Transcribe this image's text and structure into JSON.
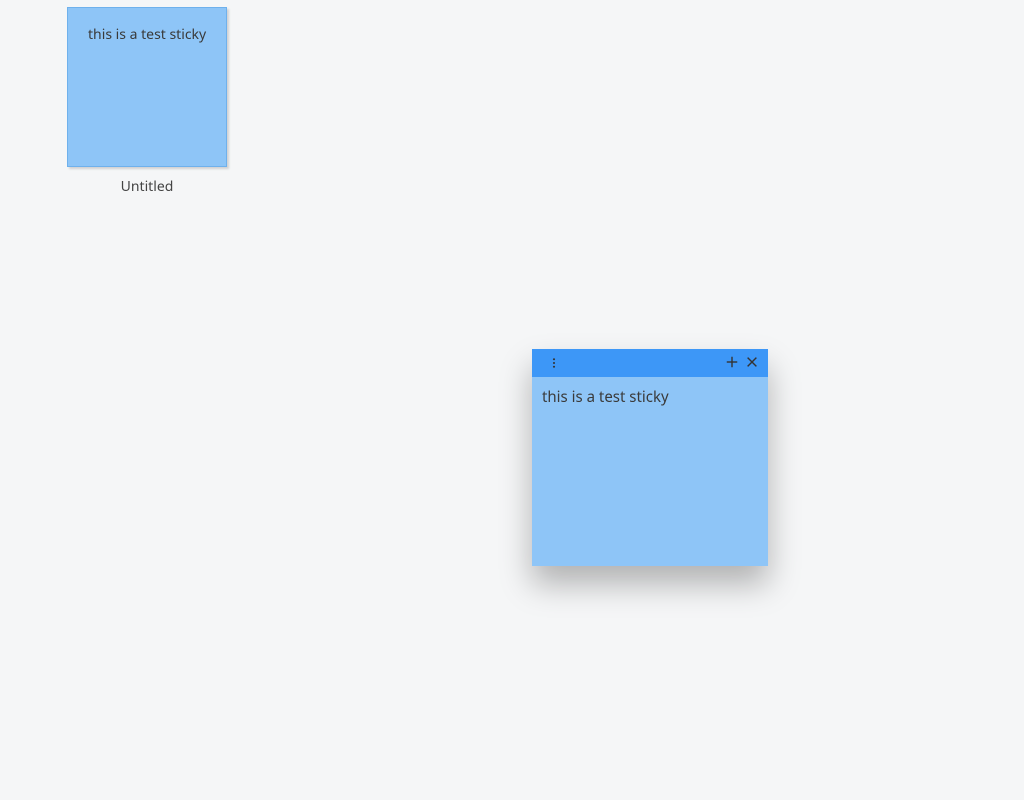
{
  "thumbnail": {
    "content": "this is a test sticky",
    "label": "Untitled"
  },
  "sticky": {
    "content": "this is a test sticky"
  },
  "colors": {
    "desktop_bg": "#f5f6f7",
    "note_bg": "#8ec5f7",
    "note_header": "#3d97f7"
  }
}
